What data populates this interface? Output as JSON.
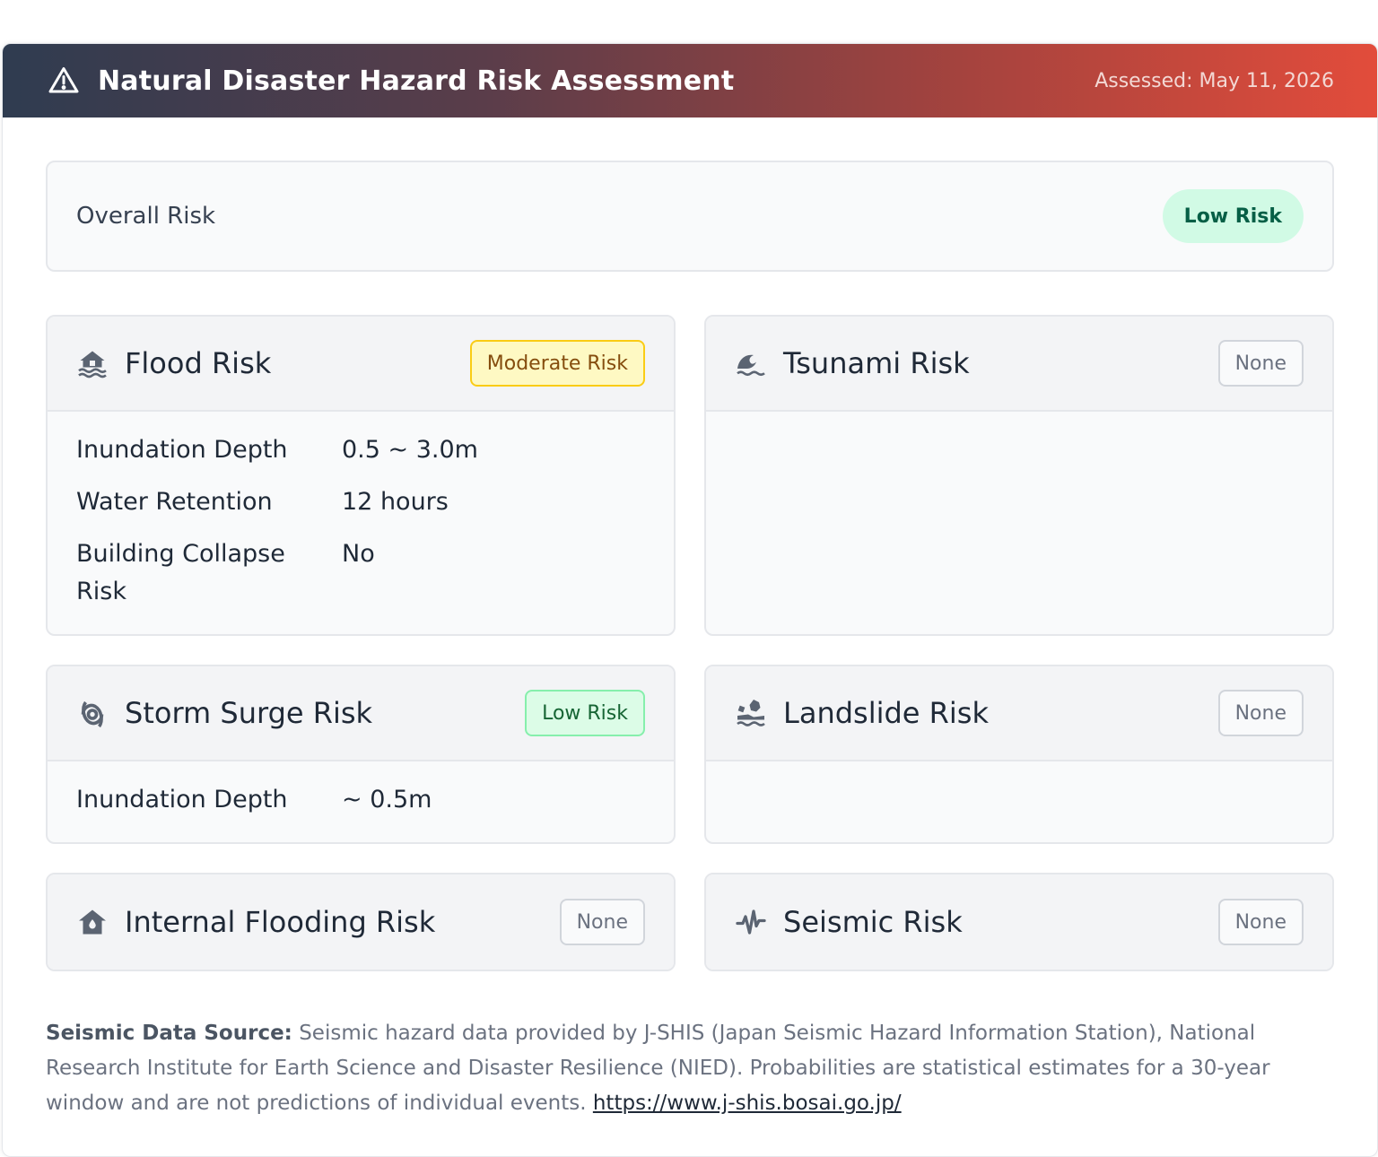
{
  "header": {
    "title": "Natural Disaster Hazard Risk Assessment",
    "assessed": "Assessed: May 11, 2026"
  },
  "overall": {
    "label": "Overall Risk",
    "badge": "Low Risk"
  },
  "cards": {
    "flood": {
      "title": "Flood Risk",
      "badge": "Moderate Risk",
      "icon": "house-flood-icon",
      "rows": [
        {
          "label": "Inundation Depth",
          "value": "0.5 ~ 3.0m"
        },
        {
          "label": "Water Retention",
          "value": "12 hours"
        },
        {
          "label": "Building Collapse Risk",
          "value": "No"
        }
      ]
    },
    "tsunami": {
      "title": "Tsunami Risk",
      "badge": "None",
      "icon": "wave-icon"
    },
    "storm_surge": {
      "title": "Storm Surge Risk",
      "badge": "Low Risk",
      "icon": "hurricane-icon",
      "rows": [
        {
          "label": "Inundation Depth",
          "value": "~ 0.5m"
        }
      ]
    },
    "landslide": {
      "title": "Landslide Risk",
      "badge": "None",
      "icon": "landslide-icon"
    },
    "internal_flooding": {
      "title": "Internal Flooding Risk",
      "badge": "None",
      "icon": "house-icon"
    },
    "seismic": {
      "title": "Seismic Risk",
      "badge": "None",
      "icon": "seismic-wave-icon"
    }
  },
  "footer": {
    "label": "Seismic Data Source:",
    "text": " Seismic hazard data provided by J-SHIS (Japan Seismic Hazard Information Station), National Research Institute for Earth Science and Disaster Resilience (NIED). Probabilities are statistical estimates for a 30-year window and are not predictions of individual events. ",
    "link": "https://www.j-shis.bosai.go.jp/"
  },
  "colors": {
    "header_gradient_start": "#2f3c50",
    "header_gradient_end": "#e24c3b",
    "low_risk_bg": "#d1fae5",
    "moderate_risk_bg": "#fef9c3",
    "moderate_risk_border": "#facc15",
    "none_border": "#d1d5db"
  }
}
